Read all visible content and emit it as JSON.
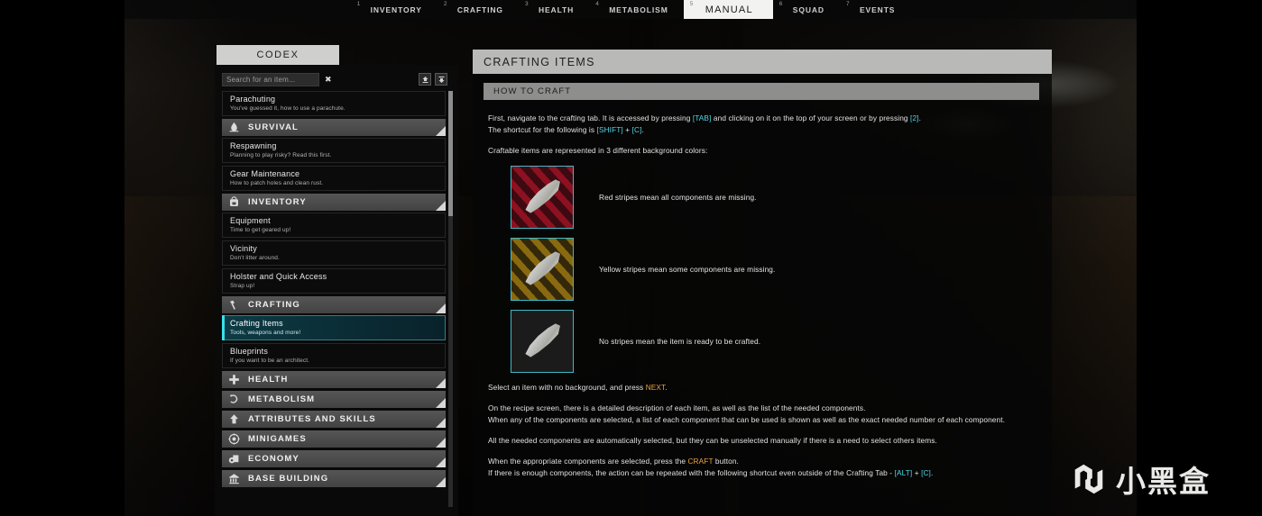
{
  "tabs": [
    {
      "num": "1",
      "label": "INVENTORY",
      "active": false
    },
    {
      "num": "2",
      "label": "CRAFTING",
      "active": false
    },
    {
      "num": "3",
      "label": "HEALTH",
      "active": false
    },
    {
      "num": "4",
      "label": "METABOLISM",
      "active": false
    },
    {
      "num": "5",
      "label": "MANUAL",
      "active": true
    },
    {
      "num": "6",
      "label": "SQUAD",
      "active": false
    },
    {
      "num": "7",
      "label": "EVENTS",
      "active": false
    }
  ],
  "sidebar": {
    "title": "CODEX",
    "search": {
      "placeholder": "Search for an item...",
      "clear": "✖"
    },
    "tree": [
      {
        "type": "entry",
        "title": "Parachuting",
        "desc": "You've guessed it, how to use a parachute.",
        "selected": false
      },
      {
        "type": "category",
        "label": "SURVIVAL",
        "icon": "campfire-icon"
      },
      {
        "type": "entry",
        "title": "Respawning",
        "desc": "Planning to play risky? Read this first.",
        "selected": false
      },
      {
        "type": "entry",
        "title": "Gear Maintenance",
        "desc": "How to patch holes and clean rust.",
        "selected": false
      },
      {
        "type": "category",
        "label": "INVENTORY",
        "icon": "backpack-icon"
      },
      {
        "type": "entry",
        "title": "Equipment",
        "desc": "Time to get geared up!",
        "selected": false
      },
      {
        "type": "entry",
        "title": "Vicinity",
        "desc": "Don't litter around.",
        "selected": false
      },
      {
        "type": "entry",
        "title": "Holster and Quick Access",
        "desc": "Strap up!",
        "selected": false
      },
      {
        "type": "category",
        "label": "CRAFTING",
        "icon": "hammer-icon"
      },
      {
        "type": "entry",
        "title": "Crafting Items",
        "desc": "Tools, weapons and more!",
        "selected": true
      },
      {
        "type": "entry",
        "title": "Blueprints",
        "desc": "If you want to be an architect.",
        "selected": false
      },
      {
        "type": "category",
        "label": "HEALTH",
        "icon": "cross-icon"
      },
      {
        "type": "category",
        "label": "METABOLISM",
        "icon": "stomach-icon"
      },
      {
        "type": "category",
        "label": "ATTRIBUTES AND SKILLS",
        "icon": "up-arrow-icon"
      },
      {
        "type": "category",
        "label": "MINIGAMES",
        "icon": "target-icon"
      },
      {
        "type": "category",
        "label": "ECONOMY",
        "icon": "coins-icon"
      },
      {
        "type": "category",
        "label": "BASE BUILDING",
        "icon": "building-icon"
      }
    ]
  },
  "main": {
    "header": "CRAFTING ITEMS",
    "section": "HOW TO CRAFT",
    "p1_a": "First, navigate to the crafting tab. It is accessed by pressing ",
    "p1_k1": "[TAB]",
    "p1_b": " and clicking on it on the top of your screen or by pressing ",
    "p1_k2": "[2]",
    "p1_c": ".",
    "p1_d": "The shortcut for the following is ",
    "p1_k3": "[SHIFT]",
    "p1_e": " + ",
    "p1_k4": "[C]",
    "p1_f": ".",
    "p2": "Craftable items are represented in 3 different background colors:",
    "legend": [
      {
        "style": "red",
        "text": "Red stripes mean all components are missing."
      },
      {
        "style": "yel",
        "text": "Yellow stripes mean some components are missing."
      },
      {
        "style": "none",
        "text": "No stripes mean the item is ready to be crafted."
      }
    ],
    "p3_a": "Select an item with no background, and press ",
    "p3_k": "NEXT",
    "p3_b": ".",
    "p4": "On the recipe screen, there is a detailed description of each item, as well as the list of the needed components.",
    "p5": "When any of the components are selected, a list of each component that can be used is shown as well as the exact needed number of each component.",
    "p6": "All the needed components are automatically selected, but they can be unselected manually if there is a need to select others items.",
    "p7_a": "When the appropriate components are selected, press the ",
    "p7_k": "CRAFT",
    "p7_b": " button.",
    "p8_a": "If there is enough components, the action can be repeated with the following shortcut even outside of the Crafting Tab - ",
    "p8_k1": "[ALT]",
    "p8_b": " + ",
    "p8_k2": "[C]",
    "p8_c": "."
  },
  "watermark": {
    "text": "小黑盒"
  },
  "colors": {
    "accent_cyan": "#4fd8e8",
    "accent_gold": "#e8a33c",
    "header_gray": "#b9b9b7"
  }
}
